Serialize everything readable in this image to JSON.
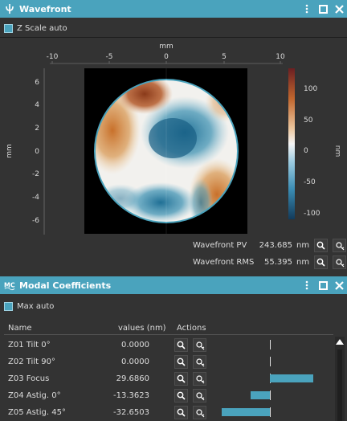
{
  "wavefront_panel": {
    "title": "Wavefront",
    "z_scale_label": "Z Scale auto",
    "x_axis_label": "mm",
    "y_axis_label": "mm",
    "colorbar_label": "nm",
    "x_ticks": [
      "-10",
      "-5",
      "0",
      "5",
      "10"
    ],
    "y_ticks": [
      "6",
      "4",
      "2",
      "0",
      "-2",
      "-4",
      "-6"
    ],
    "cbar_ticks": [
      "100",
      "50",
      "0",
      "-50",
      "-100"
    ],
    "pv_label": "Wavefront PV",
    "pv_value": "243.685",
    "pv_unit": "nm",
    "rms_label": "Wavefront RMS",
    "rms_value": "55.395",
    "rms_unit": "nm"
  },
  "modal_panel": {
    "title": "Modal Coefficients",
    "max_auto_label": "Max auto",
    "col_name": "Name",
    "col_values": "values (nm)",
    "col_actions": "Actions",
    "rows": [
      {
        "name": "Z01  Tilt 0°",
        "value": "0.0000"
      },
      {
        "name": "Z02  Tilt 90°",
        "value": "0.0000"
      },
      {
        "name": "Z03  Focus",
        "value": "29.6860"
      },
      {
        "name": "Z04  Astig. 0°",
        "value": "-13.3623"
      },
      {
        "name": "Z05  Astig. 45°",
        "value": "-32.6503"
      }
    ]
  },
  "colors": {
    "accent": "#4aa3bd",
    "bar": "#4aa3bd"
  }
}
